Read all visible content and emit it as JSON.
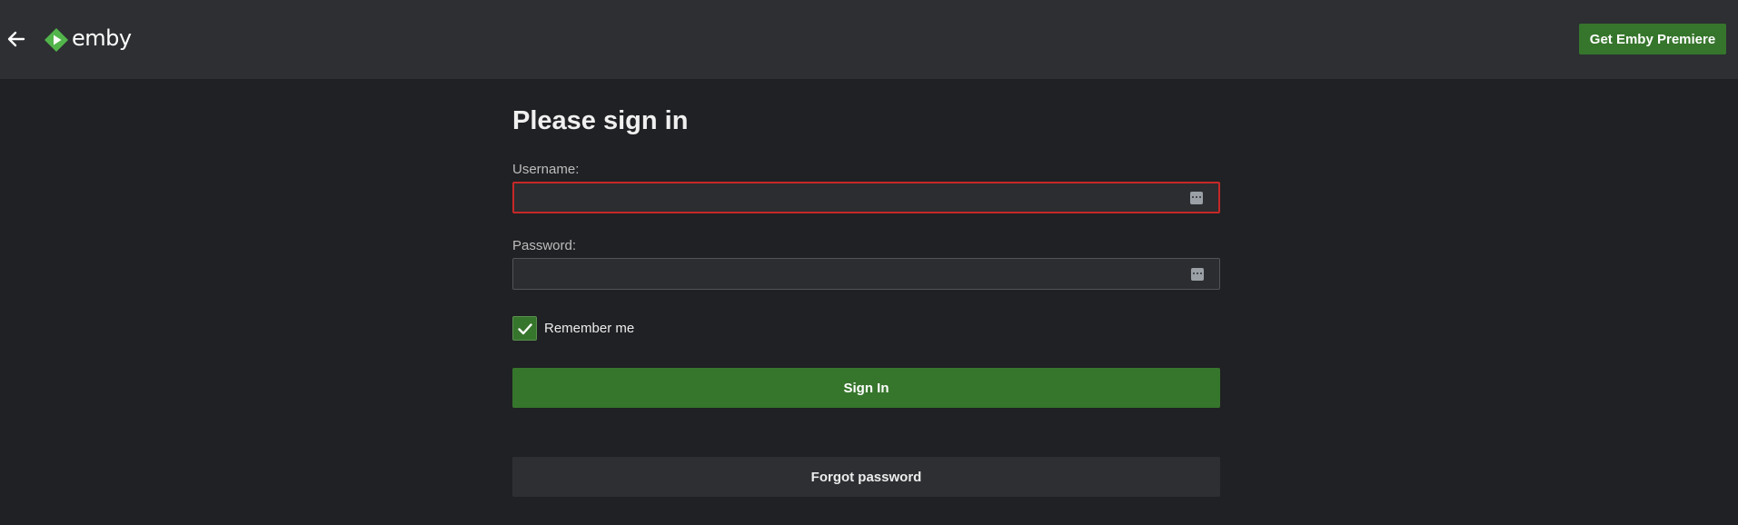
{
  "header": {
    "back_icon": "arrow-left-icon",
    "logo_text": "emby",
    "premiere_label": "Get Emby Premiere"
  },
  "login": {
    "title": "Please sign in",
    "username": {
      "label": "Username:",
      "value": "",
      "state": "error"
    },
    "password": {
      "label": "Password:",
      "value": ""
    },
    "remember_me": {
      "label": "Remember me",
      "checked": true
    },
    "sign_in_label": "Sign In",
    "forgot_password_label": "Forgot password"
  },
  "colors": {
    "accent": "#36752c",
    "error": "#c62828",
    "background": "#202124",
    "header": "#2d2f32"
  }
}
